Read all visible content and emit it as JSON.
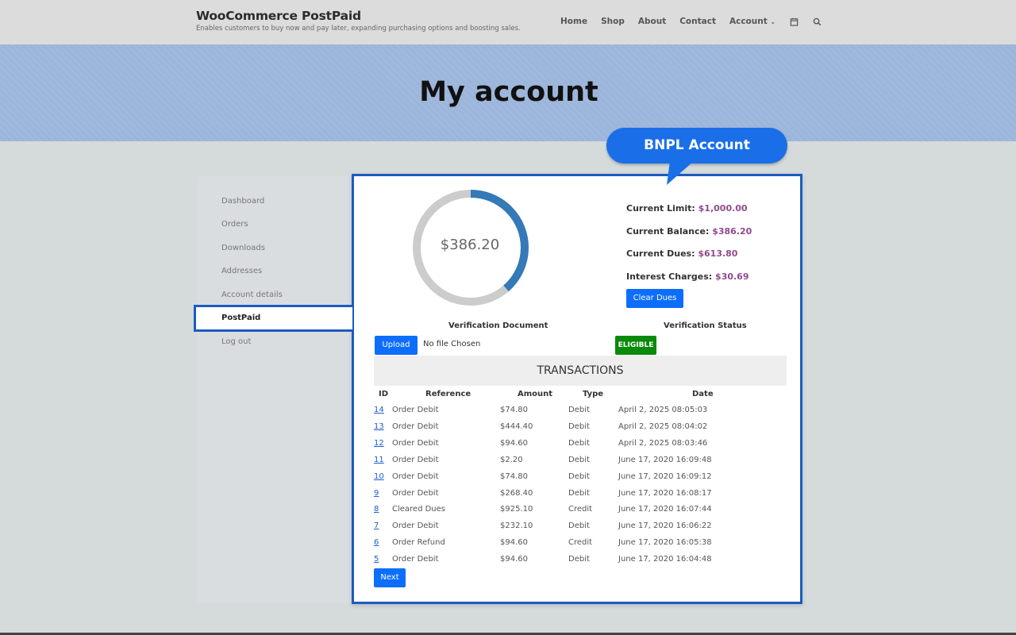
{
  "site": {
    "title": "WooCommerce PostPaid",
    "tagline": "Enables customers to buy now and pay later, expanding purchasing options and boosting sales."
  },
  "nav": {
    "items": [
      "Home",
      "Shop",
      "About",
      "Contact",
      "Account"
    ],
    "account_chevron": "⌄",
    "icons": [
      "calendar-icon",
      "search-icon"
    ]
  },
  "hero": {
    "title": "My account"
  },
  "sidebar": {
    "items": [
      "Dashboard",
      "Orders",
      "Downloads",
      "Addresses",
      "Account details",
      "PostPaid",
      "Log out"
    ],
    "active": "PostPaid"
  },
  "callout": {
    "text": "BNPL Account"
  },
  "donut": {
    "value_label": "$386.20",
    "used_fraction": 0.386,
    "fill_color": "#337ab7",
    "track_color": "#cccccc"
  },
  "stats": {
    "limit_label": "Current Limit:",
    "limit_value": "$1,000.00",
    "balance_label": "Current Balance:",
    "balance_value": "$386.20",
    "dues_label": "Current Dues:",
    "dues_value": "$613.80",
    "interest_label": "Interest Charges:",
    "interest_value": "$30.69",
    "clear_button": "Clear Dues"
  },
  "verification": {
    "doc_label": "Verification Document",
    "status_label": "Verification Status",
    "upload_button": "Upload",
    "file_text": "No file Chosen",
    "status_badge": "ELIGIBLE"
  },
  "transactions": {
    "title": "TRANSACTIONS",
    "columns": [
      "ID",
      "Reference",
      "Amount",
      "Type",
      "Date"
    ],
    "rows": [
      {
        "id": "14",
        "reference": "Order Debit",
        "amount": "$74.80",
        "type": "Debit",
        "date": "April 2, 2025 08:05:03"
      },
      {
        "id": "13",
        "reference": "Order Debit",
        "amount": "$444.40",
        "type": "Debit",
        "date": "April 2, 2025 08:04:02"
      },
      {
        "id": "12",
        "reference": "Order Debit",
        "amount": "$94.60",
        "type": "Debit",
        "date": "April 2, 2025 08:03:46"
      },
      {
        "id": "11",
        "reference": "Order Debit",
        "amount": "$2.20",
        "type": "Debit",
        "date": "June 17, 2020 16:09:48"
      },
      {
        "id": "10",
        "reference": "Order Debit",
        "amount": "$74.80",
        "type": "Debit",
        "date": "June 17, 2020 16:09:12"
      },
      {
        "id": "9",
        "reference": "Order Debit",
        "amount": "$268.40",
        "type": "Debit",
        "date": "June 17, 2020 16:08:17"
      },
      {
        "id": "8",
        "reference": "Cleared Dues",
        "amount": "$925.10",
        "type": "Credit",
        "date": "June 17, 2020 16:07:44"
      },
      {
        "id": "7",
        "reference": "Order Debit",
        "amount": "$232.10",
        "type": "Debit",
        "date": "June 17, 2020 16:06:22"
      },
      {
        "id": "6",
        "reference": "Order Refund",
        "amount": "$94.60",
        "type": "Credit",
        "date": "June 17, 2020 16:05:38"
      },
      {
        "id": "5",
        "reference": "Order Debit",
        "amount": "$94.60",
        "type": "Debit",
        "date": "June 17, 2020 16:04:48"
      }
    ],
    "next_button": "Next"
  }
}
